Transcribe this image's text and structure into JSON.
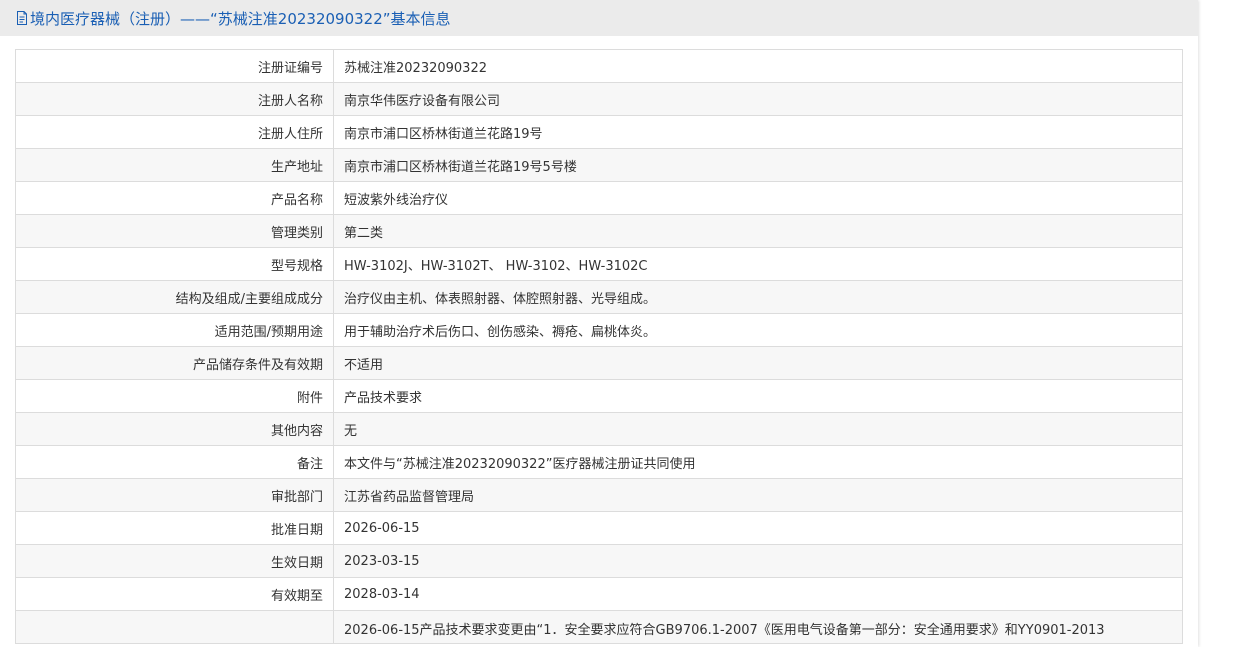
{
  "header": {
    "title": "境内医疗器械（注册）——“苏械注准20232090322”基本信息",
    "icon": "document-icon",
    "color": "#1a5fb4"
  },
  "rows": [
    {
      "label": "注册证编号",
      "value": "苏械注准20232090322"
    },
    {
      "label": "注册人名称",
      "value": "南京华伟医疗设备有限公司"
    },
    {
      "label": "注册人住所",
      "value": "南京市浦口区桥林街道兰花路19号"
    },
    {
      "label": "生产地址",
      "value": "南京市浦口区桥林街道兰花路19号5号楼"
    },
    {
      "label": "产品名称",
      "value": "短波紫外线治疗仪"
    },
    {
      "label": "管理类别",
      "value": "第二类"
    },
    {
      "label": "型号规格",
      "value": "HW-3102J、HW-3102T、 HW-3102、HW-3102C"
    },
    {
      "label": "结构及组成/主要组成成分",
      "value": "治疗仪由主机、体表照射器、体腔照射器、光导组成。"
    },
    {
      "label": "适用范围/预期用途",
      "value": "用于辅助治疗术后伤口、创伤感染、褥疮、扁桃体炎。"
    },
    {
      "label": "产品储存条件及有效期",
      "value": "不适用"
    },
    {
      "label": "附件",
      "value": "产品技术要求"
    },
    {
      "label": "其他内容",
      "value": "无"
    },
    {
      "label": "备注",
      "value": "本文件与“苏械注准20232090322”医疗器械注册证共同使用"
    },
    {
      "label": "审批部门",
      "value": "江苏省药品监督管理局"
    },
    {
      "label": "批准日期",
      "value": "2026-06-15"
    },
    {
      "label": "生效日期",
      "value": "2023-03-15"
    },
    {
      "label": "有效期至",
      "value": "2028-03-14"
    },
    {
      "label": "",
      "value": "2026-06-15产品技术要求变更由“1．安全要求应符合GB9706.1-2007《医用电气设备第一部分：安全通用要求》和YY0901-2013"
    }
  ]
}
